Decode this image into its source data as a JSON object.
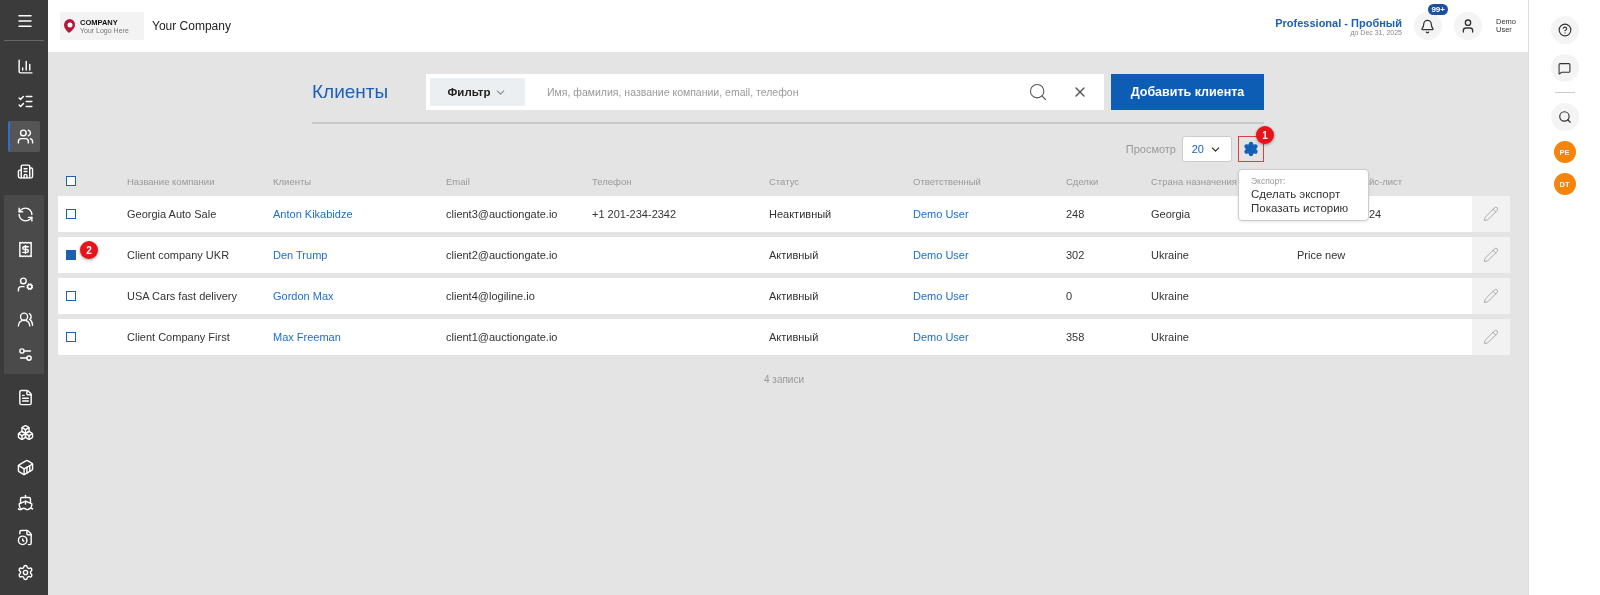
{
  "sidebar": {
    "groups": [
      {
        "highlighted": false,
        "items": [
          {
            "selected": false
          },
          {
            "selected": false
          },
          {
            "selected": true
          },
          {
            "selected": false
          }
        ]
      },
      {
        "highlighted": true,
        "items": [
          {
            "selected": false
          },
          {
            "selected": false
          },
          {
            "selected": false
          },
          {
            "selected": false
          },
          {
            "selected": false
          }
        ]
      },
      {
        "highlighted": false,
        "items": [
          {
            "selected": false
          },
          {
            "selected": false
          },
          {
            "selected": false
          },
          {
            "selected": false
          },
          {
            "selected": false
          },
          {
            "selected": false
          }
        ]
      }
    ]
  },
  "topbar": {
    "logo": {
      "name": "COMPANY",
      "tagline": "Your Logo Here"
    },
    "company_name": "Your Company",
    "plan": {
      "name": "Professional - Пробный",
      "until": "до Dec 31, 2025"
    },
    "notifications": {
      "badge": "99+"
    },
    "user": {
      "lines": [
        "Demo",
        "User"
      ]
    }
  },
  "right_rail": {
    "avatars": [
      {
        "initials": "PE",
        "color": "#f5840c"
      },
      {
        "initials": "DT",
        "color": "#f5840c"
      }
    ]
  },
  "page": {
    "title": "Клиенты",
    "filter": "Фильтр",
    "search": {
      "placeholder": "Имя, фамилия, название компании, email, телефон"
    },
    "add_button": "Добавить клиента",
    "view_label": "Просмотр",
    "page_size": "20",
    "settings_marker": "1",
    "export_menu": {
      "heading": "Экспорт:",
      "items": [
        "Сделать экспорт",
        "Показать историю"
      ]
    },
    "table": {
      "header_checked": false,
      "columns": [
        {
          "label": "Название компании"
        },
        {
          "label": "Клиенты"
        },
        {
          "label": "Email"
        },
        {
          "label": "Телефон"
        },
        {
          "label": "Статус"
        },
        {
          "label": "Ответственный"
        },
        {
          "label": "Сделки"
        },
        {
          "label": "Страна назначения"
        },
        {
          "label": "йс-лист",
          "clipped": true
        }
      ],
      "rows": [
        {
          "checked": false,
          "cells": [
            {
              "text": "Georgia Auto Sale"
            },
            {
              "text": "Anton Kikabidze",
              "link": true
            },
            {
              "text": "client3@auctiongate.io"
            },
            {
              "text": "+1 201-234-2342"
            },
            {
              "text": "Неактивный"
            },
            {
              "text": "Demo User",
              "link": true
            },
            {
              "text": "248"
            },
            {
              "text": "Georgia"
            },
            {
              "text": "24",
              "clipped": true
            }
          ]
        },
        {
          "checked": true,
          "marker": "2",
          "cells": [
            {
              "text": "Client company UKR"
            },
            {
              "text": "Den Trump",
              "link": true
            },
            {
              "text": "client2@auctiongate.io"
            },
            null,
            {
              "text": "Активный"
            },
            {
              "text": "Demo User",
              "link": true
            },
            {
              "text": "302"
            },
            {
              "text": "Ukraine"
            },
            {
              "text": "Price new"
            }
          ]
        },
        {
          "checked": false,
          "cells": [
            {
              "text": "USA Cars fast delivery"
            },
            {
              "text": "Gordon Max",
              "link": true
            },
            {
              "text": "client4@logiline.io"
            },
            null,
            {
              "text": "Активный"
            },
            {
              "text": "Demo User",
              "link": true
            },
            {
              "text": "0"
            },
            {
              "text": "Ukraine"
            },
            null
          ]
        },
        {
          "checked": false,
          "cells": [
            {
              "text": "Client Company First"
            },
            {
              "text": "Max Freeman",
              "link": true
            },
            {
              "text": "client1@auctiongate.io"
            },
            null,
            {
              "text": "Активный"
            },
            {
              "text": "Demo User",
              "link": true
            },
            {
              "text": "358"
            },
            {
              "text": "Ukraine"
            },
            null
          ]
        }
      ]
    },
    "footer": "4 записи"
  }
}
